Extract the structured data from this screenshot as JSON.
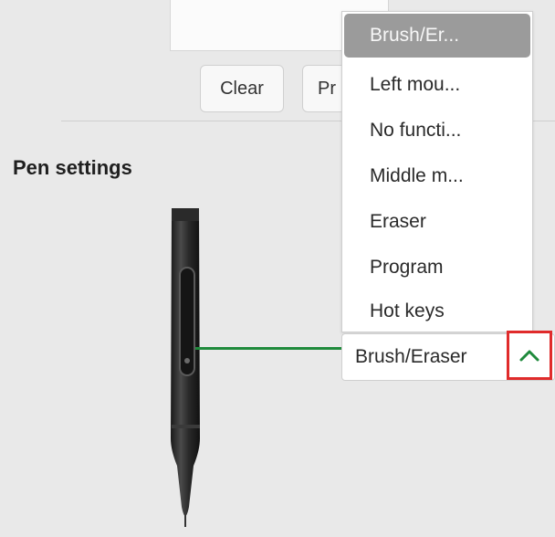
{
  "buttons": {
    "clear_label": "Clear",
    "program_partial_label": "Pr"
  },
  "section": {
    "pen_settings_title": "Pen settings"
  },
  "dropdown": {
    "selected_value": "Brush/Eraser",
    "options": [
      {
        "label": "Brush/Er...",
        "selected": true
      },
      {
        "label": "Left mou...",
        "selected": false
      },
      {
        "label": "No functi...",
        "selected": false
      },
      {
        "label": "Middle m...",
        "selected": false
      },
      {
        "label": "Eraser",
        "selected": false
      },
      {
        "label": "Program",
        "selected": false
      },
      {
        "label": "Hot keys",
        "selected": false
      }
    ]
  },
  "icons": {
    "expand_toggle": "chevron-up-icon",
    "pen": "pen-illustration"
  },
  "colors": {
    "connector_line": "#1f8a3c",
    "highlight_border": "#e02b2b",
    "selected_item_bg": "#9b9b9b",
    "chevron": "#1f8a3c"
  }
}
